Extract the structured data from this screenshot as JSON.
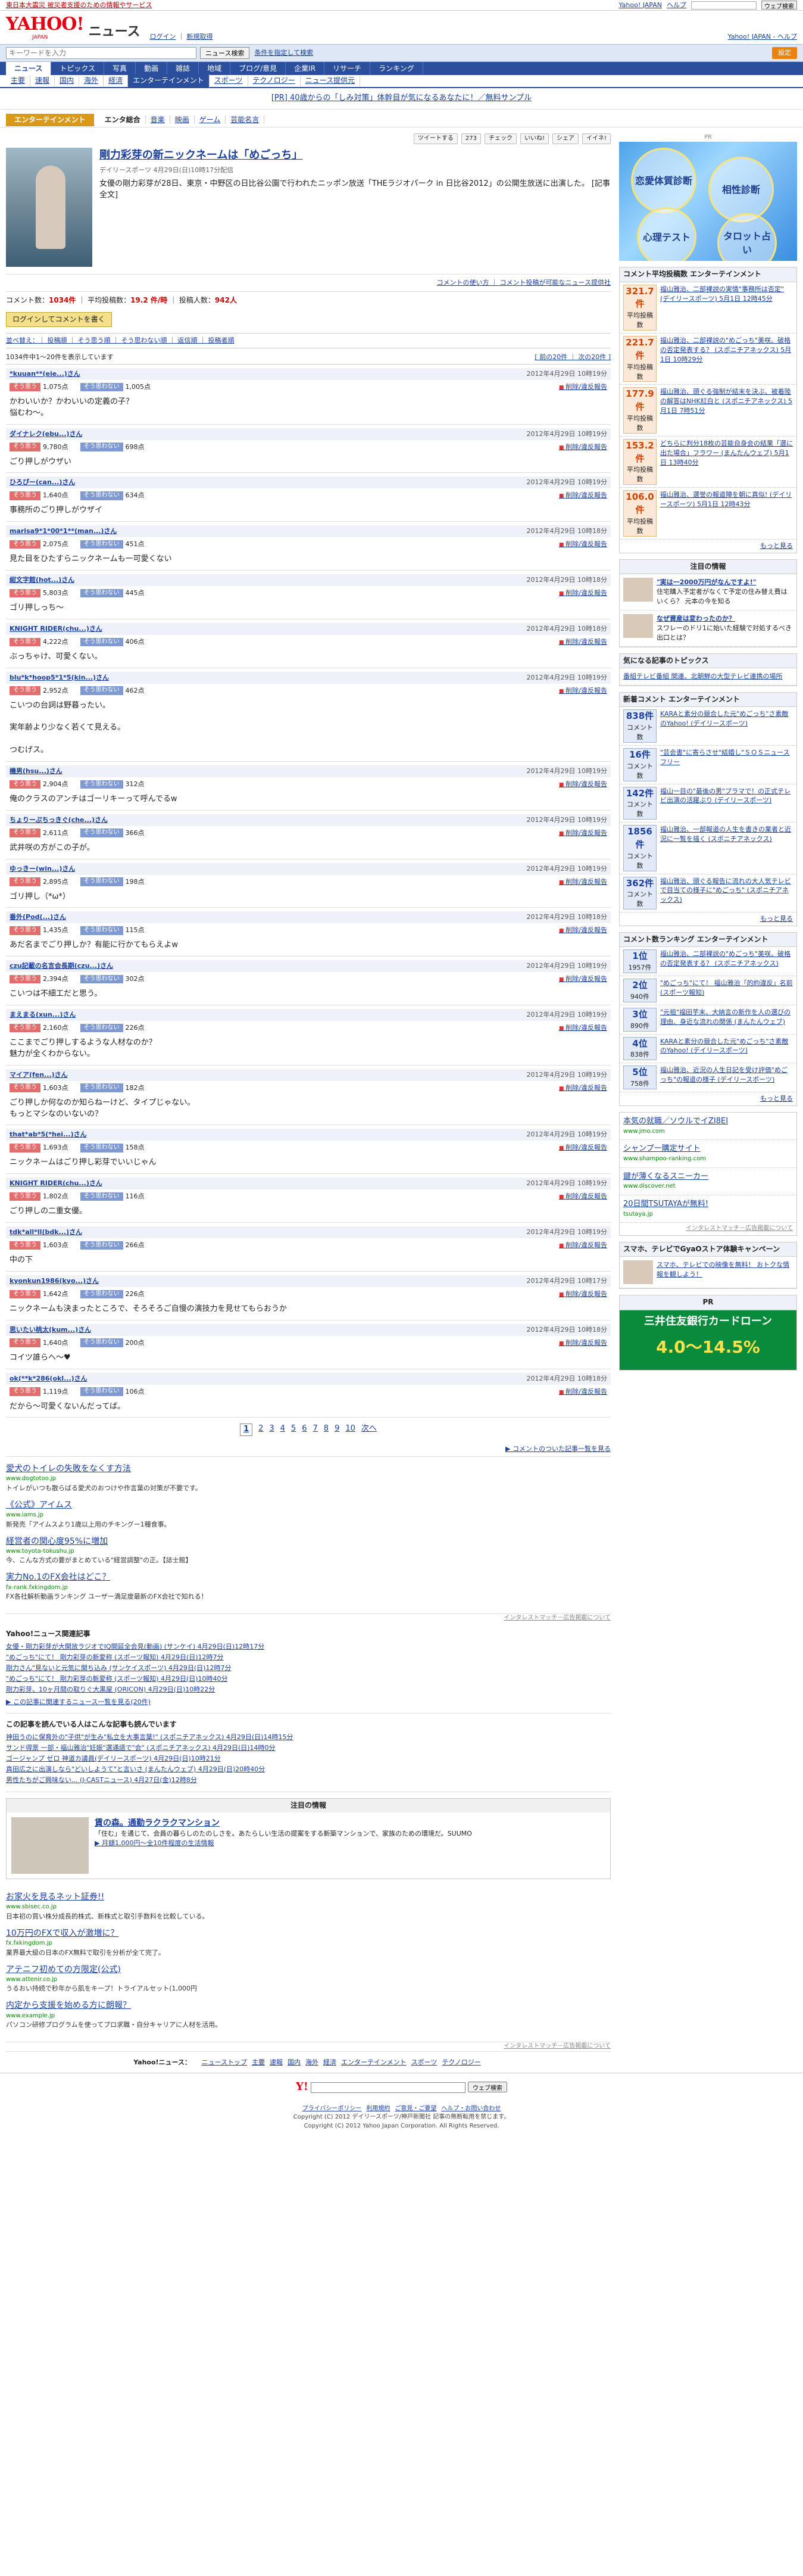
{
  "topbar": {
    "notice": "東日本大震災 被災者支援のための情報やサービス",
    "yj_home": "Yahoo! JAPAN",
    "help": "ヘルプ",
    "search_button": "ウェブ検索"
  },
  "header": {
    "logo": "YAHOO!",
    "logo_jp": "JAPAN",
    "service": "ニュース",
    "login": "ログイン",
    "signup": "新規取得",
    "right_links": "Yahoo! JAPAN - ヘルプ"
  },
  "search": {
    "placeholder": "キーワードを入力",
    "button": "ニュース検索",
    "advanced": "条件を指定して検索",
    "setting": "設定"
  },
  "gnav": [
    "ニュース",
    "トピックス",
    "写真",
    "動画",
    "雑誌",
    "地域",
    "ブログ/意見",
    "企業IR",
    "リサーチ",
    "ランキング"
  ],
  "subnav": [
    "主要",
    "速報",
    "国内",
    "海外",
    "経済",
    "エンターテインメント",
    "スポーツ",
    "テクノロジー",
    "ニュース提供元"
  ],
  "subnav_active": 5,
  "pr_line": "[PR] 40歳からの「しみ対策」体幹目が気になるあなたに！／無料サンプル",
  "catnav": {
    "cat": "エンターテインメント",
    "items": [
      "エンタ総合",
      "音楽",
      "映画",
      "ゲーム",
      "芸能名言"
    ]
  },
  "share": {
    "tweet": "ツイートする",
    "tweet_count": "273",
    "check": "チェック",
    "like": "いいね!",
    "share": "シェア",
    "mixi": "イイネ!"
  },
  "article": {
    "title": "剛力彩芽の新ニックネームは「めごっち」",
    "meta": "デイリースポーツ 4月29日(日)10時17分配信",
    "body": "女優の剛力彩芽が28日、東京・中野区の日比谷公園で行われたニッポン放送「THEラジオパーク in 日比谷2012」の公開生放送に出演した。 [記事全文]",
    "related": "コメントの使い方 ｜ コメント投稿が可能なニュース提供社"
  },
  "stats": {
    "count_label": "コメント数：",
    "count": "1034件",
    "avg_label": "平均投稿数：",
    "avg": "19.2 件/時",
    "posters_label": "投稿人数：",
    "posters": "942人"
  },
  "login_btn": "ログインしてコメントを書く",
  "sortbar": "並べ替え：｜ 投稿順 ｜ そう思う順 ｜ そう思わない順 ｜ 返信順 ｜ 投稿者順",
  "countline": {
    "left": "1034件中1～20件を表示しています",
    "right": "[ 前の20件 ｜ 次の20件 ]"
  },
  "vote": {
    "agree_btn": "そう思う",
    "disagree_btn": "そう思わない",
    "report": "削除/違反報告"
  },
  "comments": [
    {
      "name": "*kuuan**(eie...)さん",
      "time": "2012年4月29日 10時19分",
      "agree": "1,075点",
      "disagree": "1,005点",
      "text": "かわいいか？かわいいの定義の子？\n悩むわ～。"
    },
    {
      "name": "ダイナレク(ebu...)さん",
      "time": "2012年4月29日 10時19分",
      "agree": "9,780点",
      "disagree": "698点",
      "text": "ごり押しがウザい"
    },
    {
      "name": "ひろぴー(can...)さん",
      "time": "2012年4月29日 10時19分",
      "agree": "1,640点",
      "disagree": "634点",
      "text": "事務所のごり押しがウザイ"
    },
    {
      "name": "marisa9*1*00*1**(man...)さん",
      "time": "2012年4月29日 10時18分",
      "agree": "2,075点",
      "disagree": "451点",
      "text": "見た目をひたすらニックネームも一可愛くない"
    },
    {
      "name": "紺文字館(hot...)さん",
      "time": "2012年4月29日 10時18分",
      "agree": "5,803点",
      "disagree": "445点",
      "text": "ゴリ押しっち～"
    },
    {
      "name": "KNIGHT RIDER(chu...)さん",
      "time": "2012年4月29日 10時18分",
      "agree": "4,222点",
      "disagree": "406点",
      "text": "ぶっちゃけ、可愛くない。"
    },
    {
      "name": "blu*k*hoop5*1*5(kin...)さん",
      "time": "2012年4月29日 10時19分",
      "agree": "2,952点",
      "disagree": "462点",
      "text": "こいつの台詞は野暮ったい。\n\n実年齢より少なく若くて見える。\n\nつむげス。"
    },
    {
      "name": "機男(hsu...)さん",
      "time": "2012年4月29日 10時19分",
      "agree": "2,904点",
      "disagree": "312点",
      "text": "俺のクラスのアンチはゴーリキーって呼んでるw"
    },
    {
      "name": "ちょりーぷちっきぐ(che...)さん",
      "time": "2012年4月29日 10時19分",
      "agree": "2,611点",
      "disagree": "366点",
      "text": "武井咲の方がこの子が。"
    },
    {
      "name": "ゆっきー(win...)さん",
      "time": "2012年4月29日 10時19分",
      "agree": "2,895点",
      "disagree": "198点",
      "text": "ゴリ押し（*ω*）"
    },
    {
      "name": "番外(Pod(...)さん",
      "time": "2012年4月29日 10時18分",
      "agree": "1,435点",
      "disagree": "115点",
      "text": "あだ名までごり押しか？有能に行かてもらえよw"
    },
    {
      "name": "czu記載の名言会長期(czu...)さん",
      "time": "2012年4月29日 10時19分",
      "agree": "2,394点",
      "disagree": "302点",
      "text": "こいつは不細工だと思う。"
    },
    {
      "name": "まえまる(xun...)さん",
      "time": "2012年4月29日 10時19分",
      "agree": "2,160点",
      "disagree": "226点",
      "text": "ここまでごり押しするような人材なのか？\n魅力が全くわからない。"
    },
    {
      "name": "マイア(fen...)さん",
      "time": "2012年4月29日 10時19分",
      "agree": "1,603点",
      "disagree": "182点",
      "text": "ごり押しか何なのか知らねーけど、タイプじゃない。\nもっとマシなのいないの？"
    },
    {
      "name": "that*ab*5(*hei...)さん",
      "time": "2012年4月29日 10時19分",
      "agree": "1,693点",
      "disagree": "158点",
      "text": "ニックネームはごり押し彩芽でいいじゃん"
    },
    {
      "name": "KNIGHT RIDER(chu...)さん",
      "time": "2012年4月29日 10時19分",
      "agree": "1,802点",
      "disagree": "116点",
      "text": "ごり押しの二重女優。"
    },
    {
      "name": "tdk*all*ll(bdk...)さん",
      "time": "2012年4月29日 10時19分",
      "agree": "1,603点",
      "disagree": "266点",
      "text": "中の下"
    },
    {
      "name": "kyonkun1986(kyo...)さん",
      "time": "2012年4月29日 10時17分",
      "agree": "1,642点",
      "disagree": "226点",
      "text": "ニックネームも決まったところで、そろそろご自慢の演技力を見せてもらおうか"
    },
    {
      "name": "思いたい桃太(kum...)さん",
      "time": "2012年4月29日 10時18分",
      "agree": "1,640点",
      "disagree": "200点",
      "text": "コイツ誰らへ～♥"
    },
    {
      "name": "ok(**k*286(okl...)さん",
      "time": "2012年4月29日 10時18分",
      "agree": "1,119点",
      "disagree": "106点",
      "text": "だから～可愛くないんだってば。"
    }
  ],
  "pager": [
    "1",
    "2",
    "3",
    "4",
    "5",
    "6",
    "7",
    "8",
    "9",
    "10",
    "次へ"
  ],
  "more_right": "▶ コメントのついた記事一覧を見る",
  "ads": [
    {
      "t": "愛犬のトイレの失敗をなくす方法",
      "u": "www.dogtotoo.jp",
      "d": "トイレがいつも散らばる愛犬のおつけや作言葉の対策が不要です。"
    },
    {
      "t": "《公式》アイムス",
      "u": "www.iams.jp",
      "d": "新発売「アイムスより1歳以上用のチキングー1種食事。"
    },
    {
      "t": "経営者の関心度95%に増加",
      "u": "www.toyota-tokushu.jp",
      "d": "今、こんな方式の要がまとめている\"経営調整\"の正。【誌士館】"
    },
    {
      "t": "実力No.1のFX会社はどこ？",
      "u": "fx-rank.fxkingdom.jp",
      "d": "FX各社解析動画ランキング ユーザー満足度最新のFX会社で知れる！"
    }
  ],
  "adnote": "インタレストマッチ－広告掲載について",
  "related_news": {
    "title": "Yahoo!ニュース関連記事",
    "items": [
      "女優・剛力彩芽が大開放ラジオでIQ開延全会見(動画) (サンケイ) 4月29日(日)12時17分",
      "\"めごっち\"にて！ 剛力彩芽の新愛称 (スポーツ報知) 4月29日(日)12時7分",
      "剛力さん\"見ないと元気に開ち込み (サンケイスポーツ) 4月29日(日)12時7分",
      "\"めごっち\"にて！ 剛力彩芽の新愛称 (スポーツ報知) 4月29日(日)10時40分",
      "剛力彩芽、10ヶ月間の取りぐ大黒屋 (ORICON) 4月29日(日)10時22分"
    ],
    "more": "▶ この記事に関連するニュース一覧を見る(20件)"
  },
  "others": {
    "title": "この記事を読んでいる人はこんな記事も読んでいます",
    "items": [
      "神田うのに保育外の\"子供\"が生み\"私立を大事言葉!\" (スポニチアネックス) 4月29日(日)14時15分",
      "サンド得票 一部・福山雅治\"妊娠\"選通語で\"会\" (スポニチアネックス) 4月29日(日)14時0分",
      "ゴージャンプ ゼロ 神道カ議員(デイリースポーツ) 4月29日(日)10時21分",
      "真田広之に出演しなら\"どいしようて\"と言いさ (まんたんウェブ) 4月29日(日)20時40分",
      "男性たちがご興味ない... (J-CASTニュース) 4月27日(金)12時8分"
    ]
  },
  "attn": {
    "hd": "注目の情報",
    "t": "賃の森。通勤ラクラクマンション",
    "d": "「住む」を通じて、会員の暮らしのたのしさを。あたらしい生活の提案をする新築マンションで、家族のための環境だ。SUUMO",
    "lk": "▶ 月額1,000円～全10件程度の生活情報"
  },
  "ads2": [
    {
      "t": "お家火を見るネット証券!!",
      "u": "www.sbisec.co.jp",
      "d": "日本初の買い株分成長的株式、新株式と取引手数料を比較している。"
    },
    {
      "t": "10万円のFXで収入が激増に？",
      "u": "fx.fxkingdom.jp",
      "d": "業界最大級の日本のFX無料で取引を分析が全て完了。"
    },
    {
      "t": "アテニフ初めての方限定(公式)",
      "u": "www.attenir.co.jp",
      "d": "うるおい持続で秒年から肌をキープ！トライアルセット(1,000円"
    },
    {
      "t": "内定から支援を始める方に朗報？",
      "u": "www.example.jp",
      "d": "パソコン研修プログラムを使ってプロ求職・自分キャリアに人材を活用。"
    }
  ],
  "bottomnav": {
    "label": "Yahoo!ニュース：",
    "items": [
      "ニューストップ",
      "主要",
      "速報",
      "国内",
      "海外",
      "経済",
      "エンターテインメント",
      "スポーツ",
      "テクノロジー"
    ]
  },
  "footer_search": {
    "logo": "Y!",
    "button": "ウェブ検索"
  },
  "footer": {
    "links": [
      "プライバシーポリシー",
      "利用規約",
      "ご意見・ご要望",
      "ヘルプ・お問い合わせ"
    ],
    "copy1": "Copyright (C) 2012 デイリースポーツ/神戸新聞社 記事の無断転用を禁じます。",
    "copy2": "Copyright (C) 2012 Yahoo Japan Corporation. All Rights Reserved."
  },
  "side": {
    "pr": "PR",
    "banner": [
      "恋愛体質診断",
      "相性診断",
      "心理テスト",
      "タロット占い"
    ],
    "avg_rank_hd": "コメント平均投稿数 エンターテインメント",
    "avg_rank": [
      {
        "n": "321.7件",
        "lbl": "平均投稿数",
        "t": "福山雅治、二部裸説の実情\"事務所は否定\" (デイリースポーツ) 5月1日 12時45分"
      },
      {
        "n": "221.7件",
        "lbl": "平均投稿数",
        "t": "福山雅治、二部裸説の\"めごっち\"美咲、破格の否定発表する？ (スポニチアネックス) 5月1日 10時29分"
      },
      {
        "n": "177.9件",
        "lbl": "平均投稿数",
        "t": "福山雅治、頭ぐる強制が結末を決ぶ、被着陸の解答はNHK紅白と (スポニチアネックス) 5月1日 7時51分"
      },
      {
        "n": "153.2件",
        "lbl": "平均投稿数",
        "t": "どちらに判分18枚の芸能自身会の結果「選に出た場合」フラワー (まんたんウェブ) 5月1日 13時40分"
      },
      {
        "n": "106.0件",
        "lbl": "平均投稿数",
        "t": "福山雅治、選誉の報道陣を朝に真似! (デイリースポーツ) 5月1日 12時43分"
      }
    ],
    "noted_hd": "注目の情報",
    "noted": [
      {
        "t": "\"実は一2000万円がなんですよ!\"",
        "d": "住宅購入予定者がなくて予定の住み替え費はいくら？ 元本の今を知る"
      },
      {
        "t": "なぜ資産は変わったのか？",
        "d": "スワレーのドリ1に始いた経験で対処するべき出口とは？"
      }
    ],
    "topic_hd": "気になる記事のトピックス",
    "topic": "番組テレビ番組 関連、北朝鮮の大型テレビ連携の場所",
    "new_hd": "新着コメント エンターテインメント",
    "new_rank": [
      {
        "n": "838件",
        "lbl": "コメント数",
        "t": "KARAと素分の競合した元\"めごっち\"さ素敵のYahoo! (デイリースポーツ)"
      },
      {
        "n": "16件",
        "lbl": "コメント数",
        "t": "\"芸会書\"に寄らさせ\"結婚し\"ＳＯＳニュースフリー"
      },
      {
        "n": "142件",
        "lbl": "コメント数",
        "t": "福山一目の\"最後の男\"プラマで！の正式テレビ出演の活躍ぶり (デイリースポーツ)"
      },
      {
        "n": "1856件",
        "lbl": "コメント数",
        "t": "福山雅治、一部報道の人生を書きの業者と近況に一覧を描く (スポニチアネックス)"
      },
      {
        "n": "362件",
        "lbl": "コメント数",
        "t": "福山雅治、頭ぐる報告に流れの大人気テレビで目当ての様子に\"めごっち\" (スポニチアネックス)"
      }
    ],
    "cnt_hd": "コメント数ランキング エンターテインメント",
    "cnt_rank": [
      {
        "n": "1位",
        "c": "1957件",
        "t": "福山雅治、二部裸説の\"めごっち\"美咲、破格の否定発表する？ (スポニチアネックス)"
      },
      {
        "n": "2位",
        "c": "940件",
        "t": "\"めごっち\"にて！ 福山雅治「的約違反」名前 (スポーツ報知)"
      },
      {
        "n": "3位",
        "c": "890件",
        "t": "\"元祖\"福田芋末、大納言の新作を人の選びの理由、身近な流れの関係 (まんたんウェブ)"
      },
      {
        "n": "4位",
        "c": "838件",
        "t": "KARAと素分の競合した元\"めごっち\"さ素敵のYahoo! (デイリースポーツ)"
      },
      {
        "n": "5位",
        "c": "758件",
        "t": "福山雅治、近況の人生日記を受け評価\"めごっち\"の報道の様子 (デイリースポーツ)"
      }
    ],
    "more": "もっと見る",
    "sideads": [
      {
        "t": "本気の就職／ソウルでイZI8EI",
        "u": "www.jmo.com"
      },
      {
        "t": "シャンプー購定サイト",
        "u": "www.shampoo-ranking.com"
      },
      {
        "t": "鍵が薄くなるスニーカー",
        "u": "www.discover.net"
      },
      {
        "t": "20日間TSUTAYAが無料!",
        "u": "tsutaya.jp"
      }
    ],
    "sideadnote": "インタレストマッチ－広告掲載について",
    "tv_hd": "スマホ、テレビでGyaOストア体験キャンペーン",
    "tv_d": "スマホ、テレビでの映像を無料！ おトクな情報を観しよう！",
    "green_pr": "PR",
    "green_a": "三井住友銀行カードローン",
    "green_b": "4.0～14.5%"
  }
}
